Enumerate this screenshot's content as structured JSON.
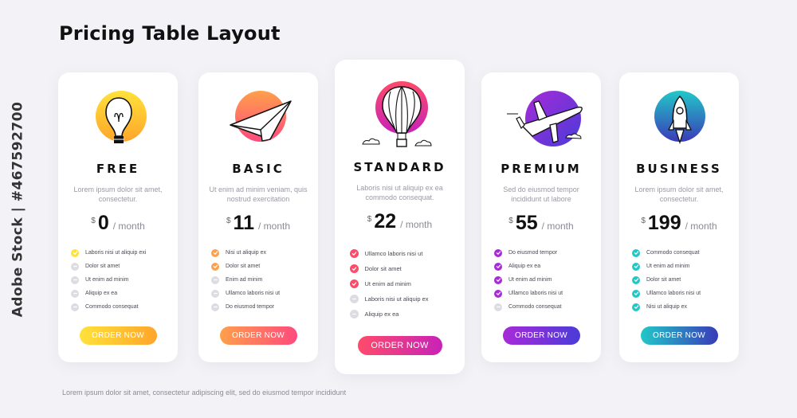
{
  "page": {
    "title": "Pricing Table Layout",
    "watermark": "Adobe Stock | #467592700",
    "footnote": "Lorem ipsum dolor sit amet, consectetur adipiscing elit, sed do eiusmod tempor incididunt"
  },
  "plans": [
    {
      "name": "FREE",
      "icon": "light-bulb-icon",
      "description": "Lorem ipsum dolor sit amet, consectetur.",
      "currency": "$",
      "price": "0",
      "period": "/ month",
      "button_label": "ORDER NOW",
      "gradient": [
        "#ffe23a",
        "#ffa52b"
      ],
      "features": [
        {
          "label": "Laboris nisi ut aliquip exi",
          "included": true
        },
        {
          "label": "Dolor sit amet",
          "included": false
        },
        {
          "label": "Ut enim ad minim",
          "included": false
        },
        {
          "label": "Aliquip ex ea",
          "included": false
        },
        {
          "label": "Commodo consequat",
          "included": false
        }
      ]
    },
    {
      "name": "BASIC",
      "icon": "paper-plane-icon",
      "description": "Ut enim ad minim veniam, quis nostrud exercitation",
      "currency": "$",
      "price": "11",
      "period": "/ month",
      "button_label": "ORDER NOW",
      "gradient": [
        "#ffa04a",
        "#ff4a7e"
      ],
      "features": [
        {
          "label": "Nisi ut aliquip ex",
          "included": true
        },
        {
          "label": "Dolor sit amet",
          "included": true
        },
        {
          "label": "Enim ad minim",
          "included": false
        },
        {
          "label": "Ullamco laboris nisi ut",
          "included": false
        },
        {
          "label": "Do eiusmod tempor",
          "included": false
        }
      ]
    },
    {
      "name": "STANDARD",
      "icon": "hot-air-balloon-icon",
      "description": "Laboris nisi ut aliquip ex ea commodo consequat.",
      "currency": "$",
      "price": "22",
      "period": "/ month",
      "button_label": "ORDER NOW",
      "gradient": [
        "#ff4b6a",
        "#c822b8"
      ],
      "features": [
        {
          "label": "Ullamco laboris nisi ut",
          "included": true
        },
        {
          "label": "Dolor sit amet",
          "included": true
        },
        {
          "label": "Ut enim ad minim",
          "included": true
        },
        {
          "label": "Laboris nisi ut aliquip ex",
          "included": false
        },
        {
          "label": "Aliquip ex ea",
          "included": false
        }
      ]
    },
    {
      "name": "PREMIUM",
      "icon": "airplane-icon",
      "description": "Sed do eiusmod tempor incididunt ut labore",
      "currency": "$",
      "price": "55",
      "period": "/ month",
      "button_label": "ORDER NOW",
      "gradient": [
        "#a72bd8",
        "#4a3bd8"
      ],
      "features": [
        {
          "label": "Do eiusmod tempor",
          "included": true
        },
        {
          "label": "Aliquip ex ea",
          "included": true
        },
        {
          "label": "Ut enim ad minim",
          "included": true
        },
        {
          "label": "Ullamco laboris nisi ut",
          "included": true
        },
        {
          "label": "Commodo consequat",
          "included": false
        }
      ]
    },
    {
      "name": "BUSINESS",
      "icon": "rocket-icon",
      "description": "Lorem ipsum dolor sit amet, consectetur.",
      "currency": "$",
      "price": "199",
      "period": "/ month",
      "button_label": "ORDER NOW",
      "gradient": [
        "#22c8c8",
        "#3a3ab8"
      ],
      "features": [
        {
          "label": "Commodo consequat",
          "included": true
        },
        {
          "label": "Ut enim ad minim",
          "included": true
        },
        {
          "label": "Dolor sit amet",
          "included": true
        },
        {
          "label": "Ullamco laboris nisi ut",
          "included": true
        },
        {
          "label": "Nisi ut aliquip ex",
          "included": true
        }
      ]
    }
  ]
}
